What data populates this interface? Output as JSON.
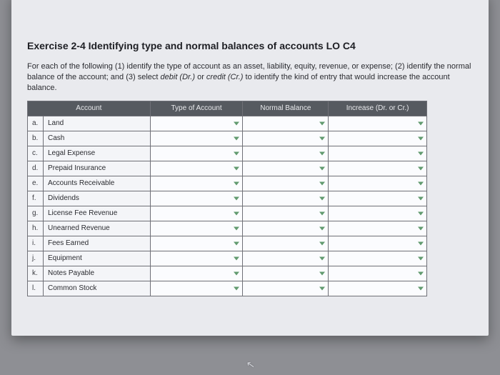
{
  "chart_data": {
    "type": "table",
    "title": "Exercise 2-4 Identifying type and normal balances of accounts LO C4",
    "columns": [
      "Account",
      "Type of Account",
      "Normal Balance",
      "Increase (Dr. or Cr.)"
    ],
    "rows": [
      {
        "letter": "a.",
        "account": "Land"
      },
      {
        "letter": "b.",
        "account": "Cash"
      },
      {
        "letter": "c.",
        "account": "Legal Expense"
      },
      {
        "letter": "d.",
        "account": "Prepaid Insurance"
      },
      {
        "letter": "e.",
        "account": "Accounts Receivable"
      },
      {
        "letter": "f.",
        "account": "Dividends"
      },
      {
        "letter": "g.",
        "account": "License Fee Revenue"
      },
      {
        "letter": "h.",
        "account": "Unearned Revenue"
      },
      {
        "letter": "i.",
        "account": "Fees Earned"
      },
      {
        "letter": "j.",
        "account": "Equipment"
      },
      {
        "letter": "k.",
        "account": "Notes Payable"
      },
      {
        "letter": "l.",
        "account": "Common Stock"
      }
    ]
  },
  "description": {
    "part1": "For each of the following (1) identify the type of account as an asset, liability, equity, revenue, or expense; (2) identify the normal balance of the account; and (3) select ",
    "em1": "debit (Dr.)",
    "mid": " or ",
    "em2": "credit (Cr.)",
    "part2": " to identify the kind of entry that would increase the account balance."
  },
  "headers": {
    "account": "Account",
    "type": "Type of Account",
    "normal": "Normal Balance",
    "increase": "Increase (Dr. or Cr.)"
  },
  "title": "Exercise 2-4 Identifying type and normal balances of accounts LO C4"
}
